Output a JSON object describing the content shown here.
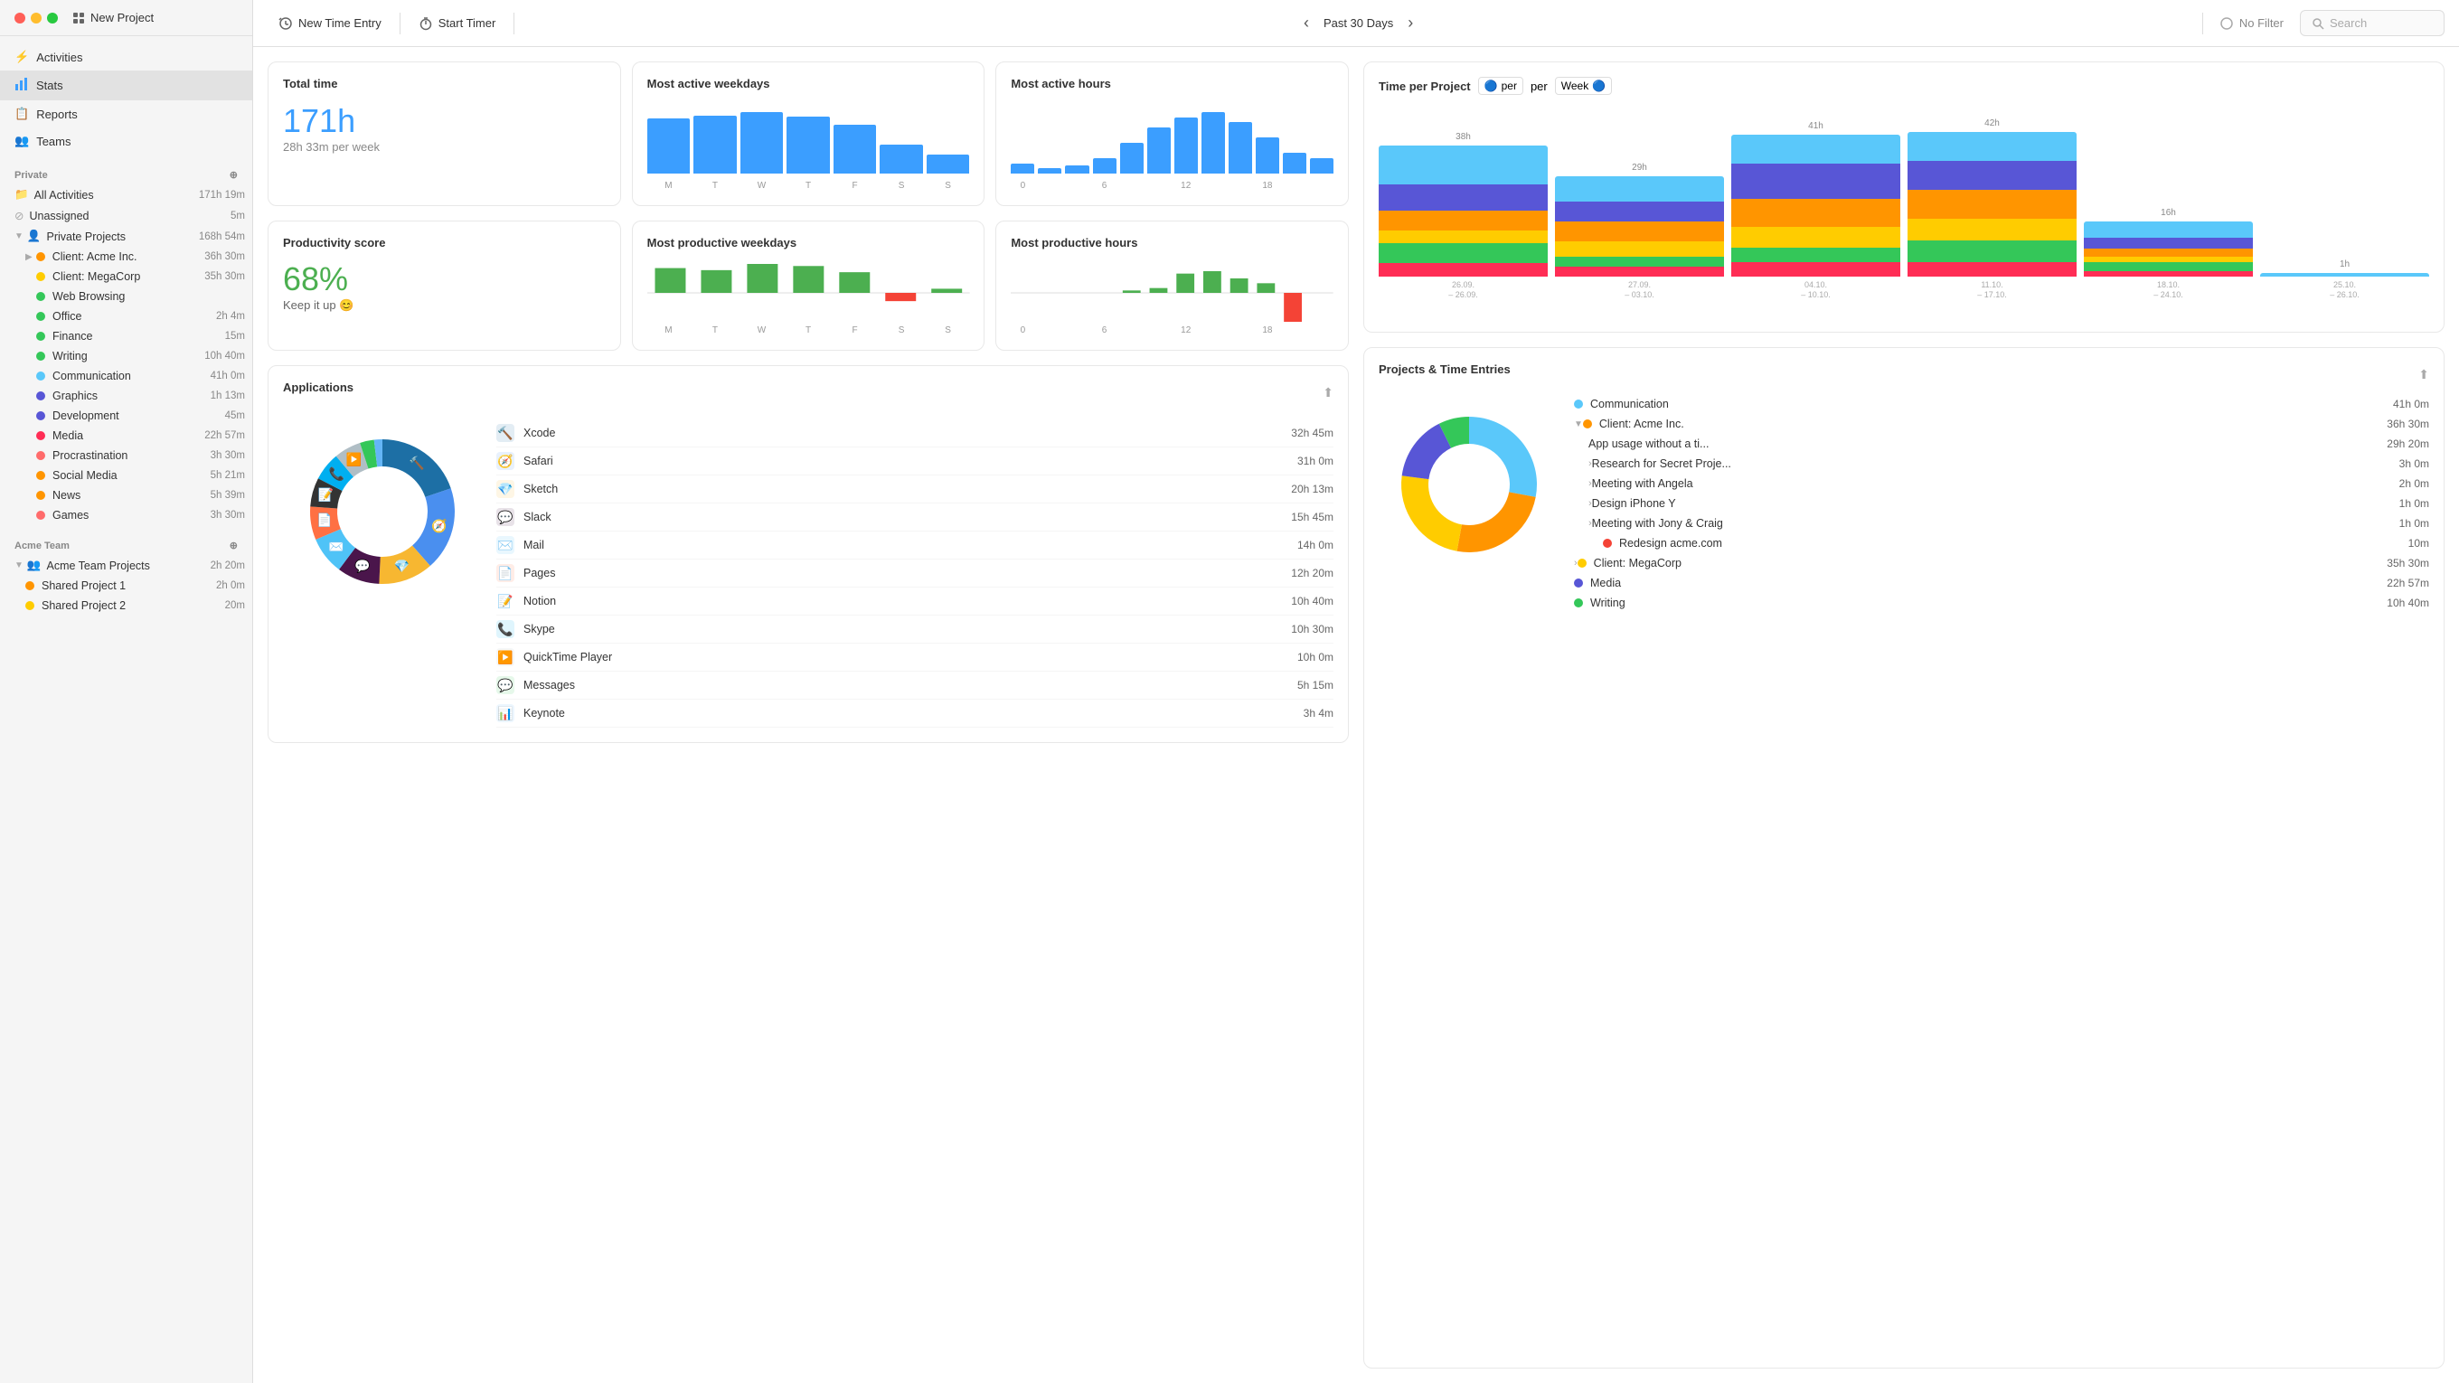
{
  "windowControls": {
    "red": "close",
    "yellow": "minimize",
    "green": "maximize"
  },
  "sidebar": {
    "newProject": "New Project",
    "navItems": [
      {
        "id": "activities",
        "label": "Activities",
        "icon": "⚡"
      },
      {
        "id": "stats",
        "label": "Stats",
        "icon": "📊",
        "active": true
      },
      {
        "id": "reports",
        "label": "Reports",
        "icon": "📋"
      },
      {
        "id": "teams",
        "label": "Teams",
        "icon": "👥"
      }
    ],
    "privateSection": "Private",
    "allActivities": {
      "label": "All Activities",
      "time": "171h 19m"
    },
    "unassigned": {
      "label": "Unassigned",
      "time": "5m"
    },
    "privateProjects": {
      "label": "Private Projects",
      "time": "168h 54m"
    },
    "projects": [
      {
        "label": "Client: Acme Inc.",
        "time": "36h 30m",
        "color": "#ff9500",
        "indent": 1
      },
      {
        "label": "Client: MegaCorp",
        "time": "35h 30m",
        "color": "#ffcc00",
        "indent": 2
      },
      {
        "label": "Web Browsing",
        "time": "",
        "color": "#34c759",
        "indent": 2
      },
      {
        "label": "Office",
        "time": "2h 4m",
        "color": "#34c759",
        "indent": 2
      },
      {
        "label": "Finance",
        "time": "15m",
        "color": "#34c759",
        "indent": 2
      },
      {
        "label": "Writing",
        "time": "10h 40m",
        "color": "#34c759",
        "indent": 2
      },
      {
        "label": "Communication",
        "time": "41h 0m",
        "color": "#5ac8fa",
        "indent": 2
      },
      {
        "label": "Graphics",
        "time": "1h 13m",
        "color": "#5856d6",
        "indent": 2
      },
      {
        "label": "Development",
        "time": "45m",
        "color": "#5856d6",
        "indent": 2
      },
      {
        "label": "Media",
        "time": "22h 57m",
        "color": "#ff2d55",
        "indent": 2
      },
      {
        "label": "Procrastination",
        "time": "3h 30m",
        "color": "#ff6b6b",
        "indent": 2
      },
      {
        "label": "Social Media",
        "time": "5h 21m",
        "color": "#ff9500",
        "indent": 2
      },
      {
        "label": "News",
        "time": "5h 39m",
        "color": "#ff9500",
        "indent": 2
      },
      {
        "label": "Games",
        "time": "3h 30m",
        "color": "#ff6b6b",
        "indent": 2
      }
    ],
    "acmeTeam": "Acme Team",
    "acmeTeamProjects": {
      "label": "Acme Team Projects",
      "time": "2h 20m"
    },
    "teamProjects": [
      {
        "label": "Shared Project 1",
        "time": "2h 0m",
        "color": "#ff9500"
      },
      {
        "label": "Shared Project 2",
        "time": "20m",
        "color": "#ffcc00"
      }
    ]
  },
  "toolbar": {
    "newTimeEntry": "New Time Entry",
    "startTimer": "Start Timer",
    "dateRange": "Past 30 Days",
    "noFilter": "No Filter",
    "searchPlaceholder": "Search"
  },
  "stats": {
    "totalTime": {
      "title": "Total time",
      "value": "171h",
      "perWeek": "28h 33m",
      "perWeekLabel": "per week"
    },
    "mostActiveWeekdays": {
      "title": "Most active weekdays",
      "bars": [
        85,
        90,
        95,
        88,
        75,
        45,
        30
      ],
      "labels": [
        "M",
        "T",
        "W",
        "T",
        "F",
        "S",
        "S"
      ]
    },
    "mostActiveHours": {
      "title": "Most active hours",
      "bars": [
        10,
        5,
        8,
        15,
        30,
        45,
        55,
        60,
        50,
        35,
        20,
        15
      ],
      "labels": [
        "0",
        "",
        "",
        "6",
        "",
        "",
        "12",
        "",
        "",
        "18",
        "",
        ""
      ]
    },
    "productivityScore": {
      "title": "Productivity score",
      "value": "68%",
      "sub": "Keep it up 😊"
    },
    "mostProductiveWeekdays": {
      "title": "Most productive weekdays",
      "bars": [
        60,
        55,
        70,
        65,
        50,
        -20,
        10
      ],
      "labels": [
        "M",
        "T",
        "W",
        "T",
        "F",
        "S",
        "S"
      ]
    },
    "mostProductiveHours": {
      "title": "Most productive hours",
      "positives": [
        0,
        0,
        0,
        0,
        5,
        10,
        40,
        45,
        30,
        20,
        0,
        0
      ],
      "negatives": [
        0,
        0,
        0,
        0,
        0,
        0,
        0,
        0,
        0,
        0,
        60,
        0
      ],
      "labels": [
        "0",
        "",
        "",
        "6",
        "",
        "",
        "12",
        "",
        "",
        "18",
        "",
        ""
      ]
    }
  },
  "timePerProject": {
    "title": "Time per Project",
    "perLabel": "per",
    "weekLabel": "Week",
    "topLabels": [
      "38h",
      "29h",
      "41h",
      "42h",
      "16h",
      "1h"
    ],
    "dateLabels": [
      "26.09.\n– 26.09.",
      "27.09.\n– 03.10.",
      "04.10.\n– 10.10.",
      "11.10.\n– 17.10.",
      "18.10.\n– 24.10.",
      "25.10.\n– 26.10."
    ],
    "colors": [
      "#5ac8fa",
      "#5856d6",
      "#ff9500",
      "#ffcc00",
      "#34c759",
      "#ff2d55",
      "#ff6b6b",
      "#4cd964"
    ]
  },
  "applications": {
    "title": "Applications",
    "list": [
      {
        "name": "Xcode",
        "time": "32h 45m",
        "icon": "🔨",
        "color": "#1d6fa5"
      },
      {
        "name": "Safari",
        "time": "31h 0m",
        "icon": "🧭",
        "color": "#006cff"
      },
      {
        "name": "Sketch",
        "time": "20h 13m",
        "icon": "💎",
        "color": "#f7b731"
      },
      {
        "name": "Slack",
        "time": "15h 45m",
        "icon": "💬",
        "color": "#4a154b"
      },
      {
        "name": "Mail",
        "time": "14h 0m",
        "icon": "✉️",
        "color": "#4fc3f7"
      },
      {
        "name": "Pages",
        "time": "12h 20m",
        "icon": "📄",
        "color": "#ff7043"
      },
      {
        "name": "Notion",
        "time": "10h 40m",
        "icon": "📝",
        "color": "#333"
      },
      {
        "name": "Skype",
        "time": "10h 30m",
        "icon": "📞",
        "color": "#00aff0"
      },
      {
        "name": "QuickTime Player",
        "time": "10h 0m",
        "icon": "▶️",
        "color": "#4fc3f7"
      },
      {
        "name": "Messages",
        "time": "5h 15m",
        "icon": "💬",
        "color": "#34c759"
      },
      {
        "name": "Keynote",
        "time": "3h 4m",
        "icon": "📊",
        "color": "#4fc3f7"
      }
    ]
  },
  "projectsTimeEntries": {
    "title": "Projects & Time Entries",
    "entries": [
      {
        "label": "Communication",
        "time": "41h 0m",
        "color": "#5ac8fa",
        "indent": 0
      },
      {
        "label": "Client: Acme Inc.",
        "time": "36h 30m",
        "color": "#ff9500",
        "indent": 0,
        "expanded": true
      },
      {
        "label": "App usage without a ti...",
        "time": "29h 20m",
        "color": null,
        "indent": 1
      },
      {
        "label": "Research for Secret Proje...",
        "time": "3h 0m",
        "color": null,
        "indent": 1,
        "arrow": true
      },
      {
        "label": "Meeting with Angela",
        "time": "2h 0m",
        "color": null,
        "indent": 1,
        "arrow": true
      },
      {
        "label": "Design iPhone Y",
        "time": "1h 0m",
        "color": null,
        "indent": 1,
        "arrow": true
      },
      {
        "label": "Meeting with Jony & Craig",
        "time": "1h 0m",
        "color": null,
        "indent": 1,
        "arrow": true
      },
      {
        "label": "Redesign acme.com",
        "time": "10m",
        "color": "#f44336",
        "indent": 2
      },
      {
        "label": "Client: MegaCorp",
        "time": "35h 30m",
        "color": "#ffcc00",
        "indent": 0,
        "arrow": true
      },
      {
        "label": "Media",
        "time": "22h 57m",
        "color": "#5856d6",
        "indent": 0
      },
      {
        "label": "Writing",
        "time": "10h 40m",
        "color": "#34c759",
        "indent": 0
      }
    ]
  }
}
